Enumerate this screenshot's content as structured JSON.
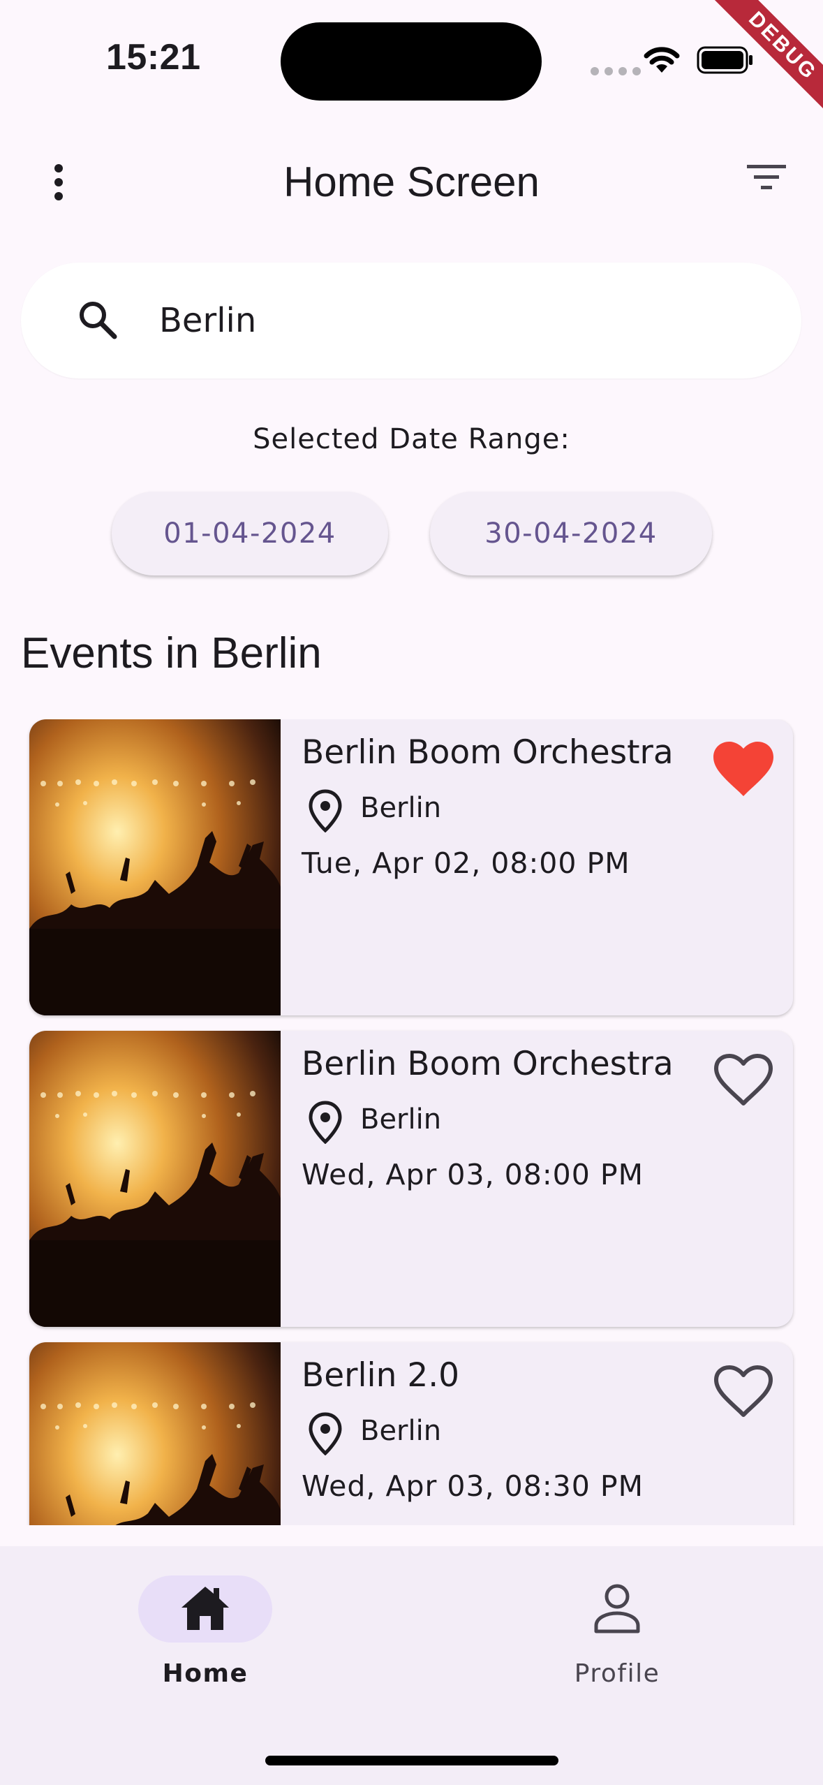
{
  "status_bar": {
    "time": "15:21",
    "debug_label": "DEBUG"
  },
  "app_bar": {
    "title": "Home Screen",
    "menu_icon": "more-vert-icon",
    "filter_icon": "filter-list-icon"
  },
  "search": {
    "value": "Berlin",
    "icon": "search-icon"
  },
  "date_range": {
    "label": "Selected Date Range:",
    "start": "01-04-2024",
    "end": "30-04-2024"
  },
  "section_title": "Events in Berlin",
  "events": [
    {
      "title": "Berlin Boom Orchestra",
      "city": "Berlin",
      "date": "Tue, Apr 02, 08:00 PM",
      "favorite": true
    },
    {
      "title": "Berlin Boom Orchestra",
      "city": "Berlin",
      "date": "Wed, Apr 03, 08:00 PM",
      "favorite": false
    },
    {
      "title": "Berlin 2.0",
      "city": "Berlin",
      "date": "Wed, Apr 03, 08:30 PM",
      "favorite": false
    }
  ],
  "bottom_nav": {
    "items": [
      {
        "label": "Home",
        "icon": "home-icon",
        "selected": true
      },
      {
        "label": "Profile",
        "icon": "person-icon",
        "selected": false
      }
    ]
  },
  "colors": {
    "background": "#FDF7FD",
    "card": "#F3EDF7",
    "accent": "#65558F",
    "favorite": "#F44336",
    "nav_indicator": "#E8DEF8"
  }
}
